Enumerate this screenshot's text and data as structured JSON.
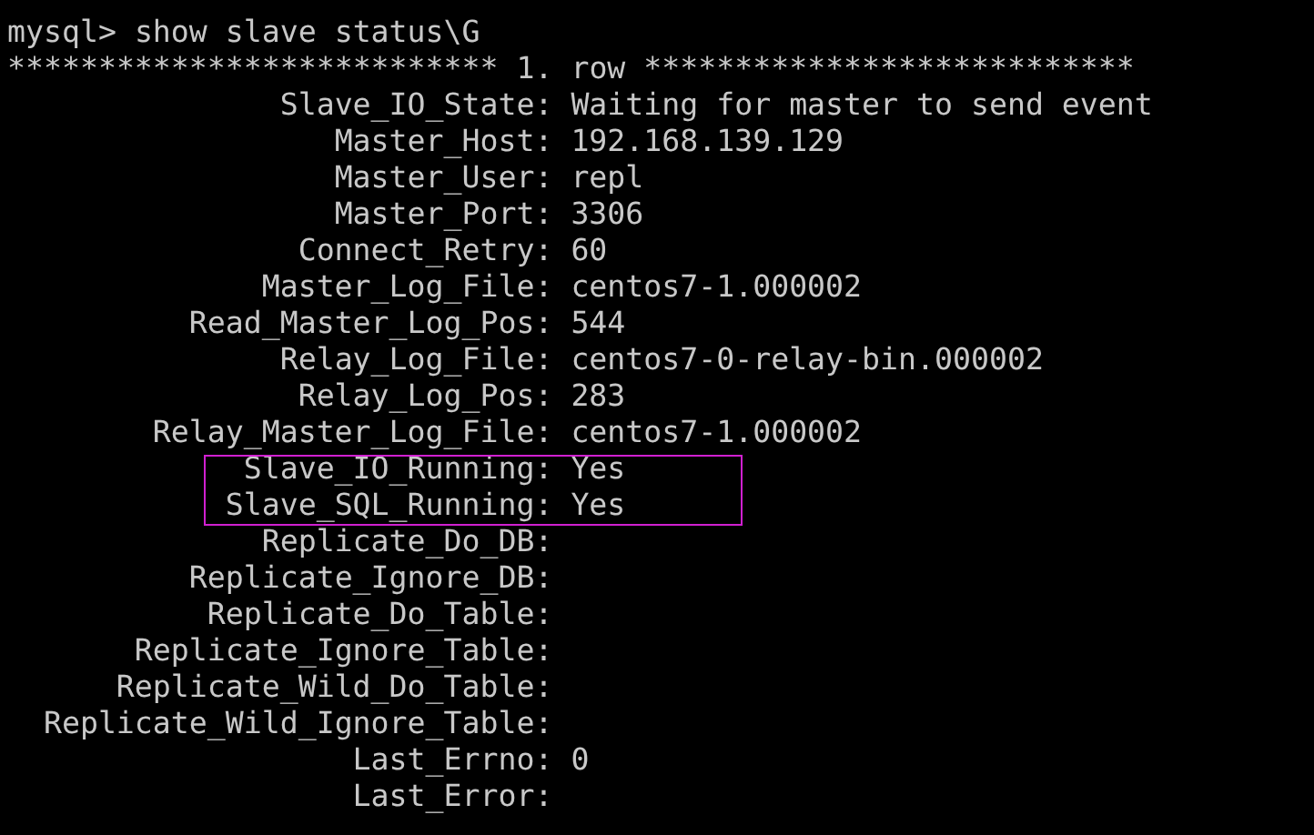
{
  "terminal": {
    "prompt": "mysql>",
    "command": "show slave status\\G",
    "row_header": "*************************** 1. row ***************************",
    "fields": [
      {
        "label": "Slave_IO_State:",
        "value": "Waiting for master to send event",
        "highlighted": false
      },
      {
        "label": "Master_Host:",
        "value": "192.168.139.129",
        "highlighted": false
      },
      {
        "label": "Master_User:",
        "value": "repl",
        "highlighted": false
      },
      {
        "label": "Master_Port:",
        "value": "3306",
        "highlighted": false
      },
      {
        "label": "Connect_Retry:",
        "value": "60",
        "highlighted": false
      },
      {
        "label": "Master_Log_File:",
        "value": "centos7-1.000002",
        "highlighted": false
      },
      {
        "label": "Read_Master_Log_Pos:",
        "value": "544",
        "highlighted": false
      },
      {
        "label": "Relay_Log_File:",
        "value": "centos7-0-relay-bin.000002",
        "highlighted": false
      },
      {
        "label": "Relay_Log_Pos:",
        "value": "283",
        "highlighted": false
      },
      {
        "label": "Relay_Master_Log_File:",
        "value": "centos7-1.000002",
        "highlighted": false
      },
      {
        "label": "Slave_IO_Running:",
        "value": "Yes",
        "highlighted": true
      },
      {
        "label": "Slave_SQL_Running:",
        "value": "Yes",
        "highlighted": true
      },
      {
        "label": "Replicate_Do_DB:",
        "highlighted": false
      },
      {
        "label": "Replicate_Ignore_DB:",
        "highlighted": false
      },
      {
        "label": "Replicate_Do_Table:",
        "highlighted": false
      },
      {
        "label": "Replicate_Ignore_Table:",
        "highlighted": false
      },
      {
        "label": "Replicate_Wild_Do_Table:",
        "highlighted": false
      },
      {
        "label": "Replicate_Wild_Ignore_Table:",
        "highlighted": false
      },
      {
        "label": "Last_Errno:",
        "value": "0",
        "highlighted": false
      },
      {
        "label": "Last_Error:",
        "highlighted": false
      }
    ]
  }
}
